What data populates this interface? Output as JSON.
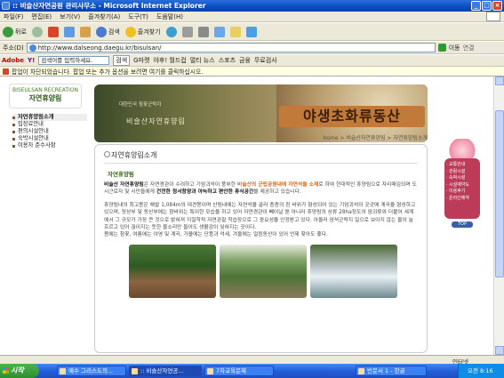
{
  "window": {
    "title": ":: 비슬산자연공원 관리사무소 - Microsoft Internet Explorer"
  },
  "menu": [
    "파일(F)",
    "편집(E)",
    "보기(V)",
    "즐겨찾기(A)",
    "도구(T)",
    "도움말(H)"
  ],
  "toolbar": {
    "back": "뒤로",
    "search": "검색",
    "favorites": "즐겨찾기"
  },
  "address": {
    "label": "주소(D)",
    "url": "http://www.dalseong.daegu.kr/bisulsan/",
    "go": "이동",
    "links": "연결"
  },
  "links": {
    "brand": "Adobe",
    "yahoo": "Y!",
    "search_placeholder": "검색어를 입력하세요.",
    "search_btn": "검색",
    "items": [
      "G마켓",
      "야후! 월드컵",
      "멀티 뉴스",
      "스포츠",
      "금융",
      "무료검사"
    ]
  },
  "infobar": {
    "text": "팝업이 차단되었습니다.  팝업 또는 추가 옵션을 보려면 여기를 클릭하십시오."
  },
  "site": {
    "logo_top": "BISEULSAN RECREATION",
    "logo_name": "자연휴양림",
    "side_menu": [
      "자연휴양림소개",
      "입장료안내",
      "편의시설안내",
      "숙박시설안내",
      "이용자 준수사항"
    ],
    "banner_small": "대한민국 참꽃군락지",
    "banner_caption": "비슬산자연휴양림",
    "banner_sign": "야생초화류동산",
    "breadcrumb": "home > 비슬산자연휴양림 > 자연휴양림소개",
    "section_title": "자연휴양림소개",
    "subsection": "자연휴양림",
    "p1_pre": "비슬산 자연휴양림",
    "p1_a": "은 자연경관이 수려하고 기암괴석이 풍부한 ",
    "p1_hl": "비슬산의 군립공원내에 자연석을 소재",
    "p1_b": "로 하여 현대적인 휴양림으로 자리매김되며 도시근로자 및 시민들에게 ",
    "p1_b2": "건전한 정서함양과 아늑하고 편안한 휴식공간",
    "p1_c": "을 제공하고 있습니다.",
    "p2": "휴양림내의 최고봉은 해발 1,084m의 대견봉이며 산림내에는 자연석을 골라 층층의 흰 바위가 형성되어 있는 기암괴석이 곳곳에 계곡을 형성하고 있으며, 정상부 및 동산부에는 참바위는 특이한 모습을 하고 있어 자연경관이 빼어날 뿐 아니라 휴양림의 상류 28ha정도의 암괴류와 더불어 세계에서 그 규모가 가장 큰 것으로 밝혀져 지질학적 자연관찰 학습장으로 그 중요성을 인정받고 있다. 아울러 암석군락지 일으로 보이지 않는 물이 늘 흐르고 있어 끊이지는 뜻한 물소리만 들어도 생활감이 잊혀지는 곳이다.",
    "p3": "봄에는 참꽃, 여름에는 야영 및 계곡, 가을에는 단풍과 억새, 겨울에는 얼음동산이 있어 언제 찾아도 좋다."
  },
  "quick": {
    "items": [
      "교통안내",
      "관람시설",
      "숙박시설",
      "시설예약도",
      "이용후기",
      "온라인예약"
    ],
    "top": "TOP"
  },
  "status": {
    "zone": "인터넷"
  },
  "taskbar": {
    "start": "시작",
    "tasks": [
      "예수 그리스도의...",
      ":: 비슬산자연공...",
      "7차교육문제",
      "빈문서 1 - 한글"
    ],
    "clock": "오전 8:16"
  }
}
